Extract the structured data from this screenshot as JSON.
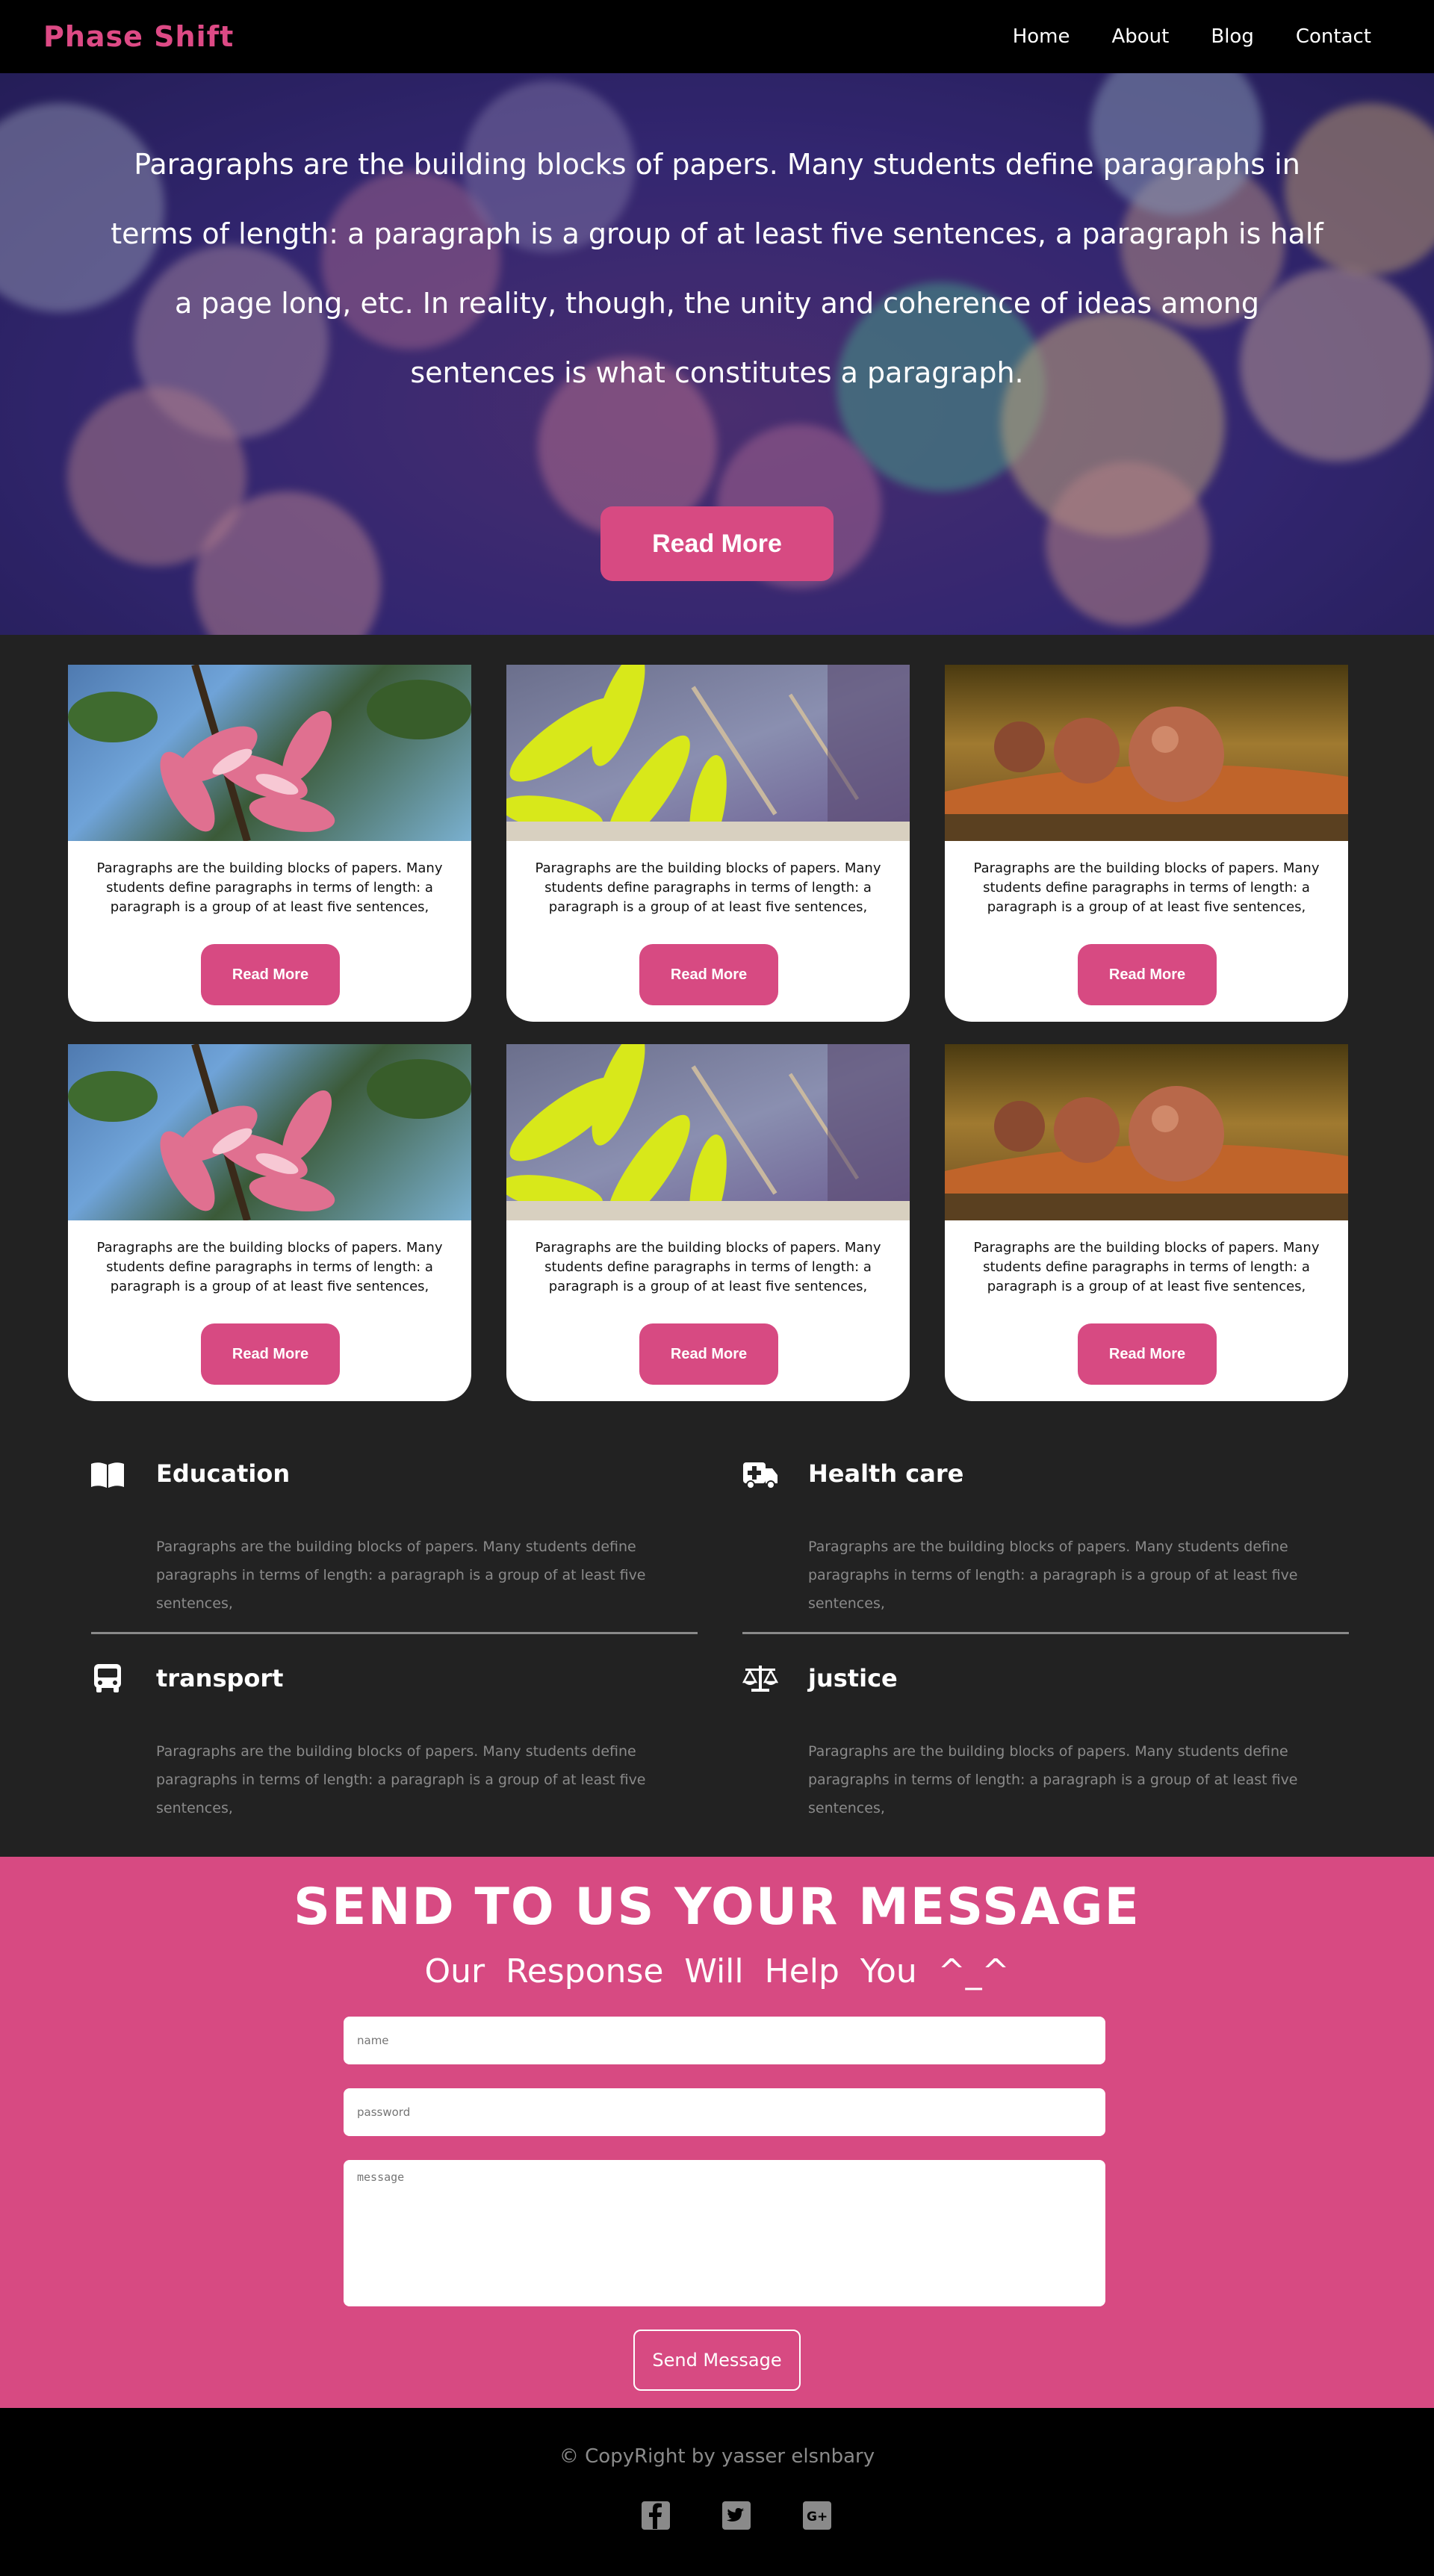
{
  "nav": {
    "logo": "Phase Shift",
    "links": [
      "Home",
      "About",
      "Blog",
      "Contact"
    ]
  },
  "hero": {
    "text": "Paragraphs are the building blocks of papers. Many students define paragraphs in terms of length: a paragraph is a group of at least five sentences, a paragraph is half a page long, etc. In reality, though, the unity and coherence of ideas among sentences is what constitutes a paragraph.",
    "button": "Read More"
  },
  "cards": [
    {
      "image": "pink-flowers-image",
      "text": "Paragraphs are the building blocks of papers. Many students define paragraphs in terms of length: a paragraph is a group of at least five sentences,",
      "button": "Read More"
    },
    {
      "image": "yellow-leaves-image",
      "text": "Paragraphs are the building blocks of papers. Many students define paragraphs in terms of length: a paragraph is a group of at least five sentences,",
      "button": "Read More"
    },
    {
      "image": "brown-spheres-image",
      "text": "Paragraphs are the building blocks of papers. Many students define paragraphs in terms of length: a paragraph is a group of at least five sentences,",
      "button": "Read More"
    },
    {
      "image": "pink-flowers-image",
      "text": "Paragraphs are the building blocks of papers. Many students define paragraphs in terms of length: a paragraph is a group of at least five sentences,",
      "button": "Read More"
    },
    {
      "image": "yellow-leaves-image",
      "text": "Paragraphs are the building blocks of papers. Many students define paragraphs in terms of length: a paragraph is a group of at least five sentences,",
      "button": "Read More"
    },
    {
      "image": "brown-spheres-image",
      "text": "Paragraphs are the building blocks of papers. Many students define paragraphs in terms of length: a paragraph is a group of at least five sentences,",
      "button": "Read More"
    }
  ],
  "features": [
    {
      "icon": "book-icon",
      "title": "Education",
      "text": "Paragraphs are the building blocks of papers. Many students define paragraphs in terms of length: a paragraph is a group of at least five sentences,"
    },
    {
      "icon": "ambulance-icon",
      "title": "Health care",
      "text": "Paragraphs are the building blocks of papers. Many students define paragraphs in terms of length: a paragraph is a group of at least five sentences,"
    },
    {
      "icon": "bus-icon",
      "title": "transport",
      "text": "Paragraphs are the building blocks of papers. Many students define paragraphs in terms of length: a paragraph is a group of at least five sentences,"
    },
    {
      "icon": "balance-scale-icon",
      "title": "justice",
      "text": "Paragraphs are the building blocks of papers. Many students define paragraphs in terms of length: a paragraph is a group of at least five sentences,"
    }
  ],
  "contact": {
    "title": "SEND TO US YOUR MESSAGE",
    "subtitle": "Our Response Will Help You ^_^",
    "name_placeholder": "name",
    "password_placeholder": "password",
    "message_placeholder": "message",
    "button": "Send Message"
  },
  "footer": {
    "copyright": "© CopyRight by yasser elsnbary",
    "social": [
      "facebook-icon",
      "twitter-icon",
      "google-plus-icon"
    ]
  },
  "colors": {
    "accent": "#d74a82",
    "logo": "#dd4a85",
    "background": "#222222",
    "nav_background": "#000000"
  }
}
